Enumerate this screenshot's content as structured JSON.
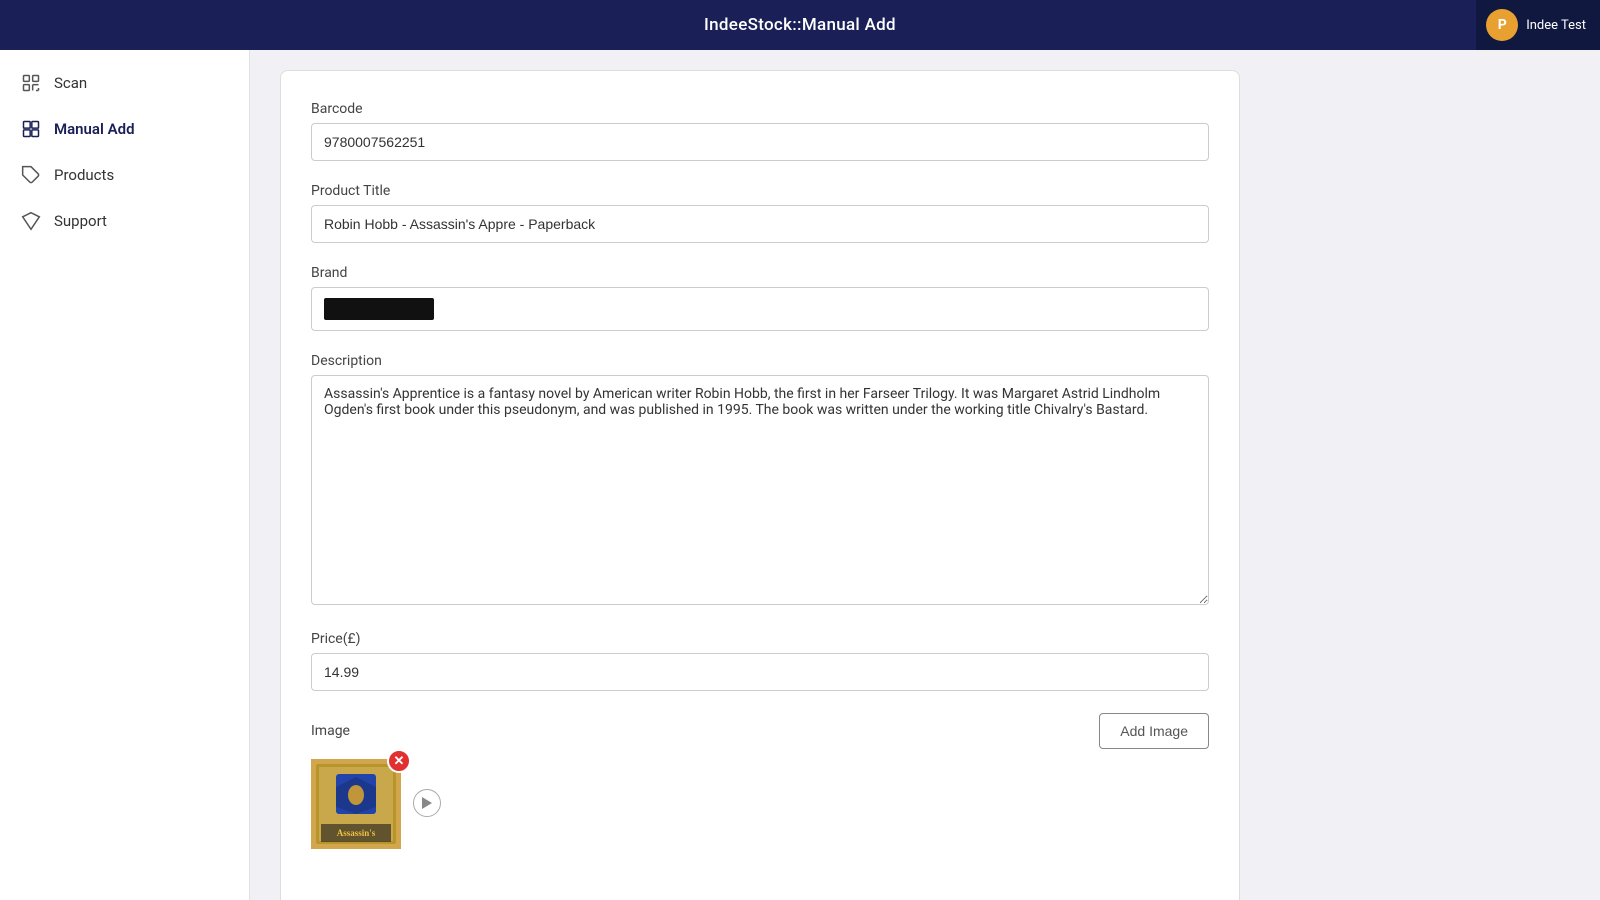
{
  "app": {
    "title": "IndeeStock::Manual Add"
  },
  "user": {
    "initial": "P",
    "name": "Indee Test",
    "avatar_color": "#e8a030"
  },
  "sidebar": {
    "items": [
      {
        "id": "scan",
        "label": "Scan",
        "icon": "scan-icon"
      },
      {
        "id": "manual-add",
        "label": "Manual Add",
        "icon": "grid-icon",
        "active": true
      },
      {
        "id": "products",
        "label": "Products",
        "icon": "tag-icon"
      },
      {
        "id": "support",
        "label": "Support",
        "icon": "diamond-icon"
      }
    ]
  },
  "form": {
    "barcode_label": "Barcode",
    "barcode_value": "9780007562251",
    "product_title_label": "Product Title",
    "product_title_value": "Robin Hobb - Assassin's Appre - Paperback",
    "brand_label": "Brand",
    "brand_value": "",
    "description_label": "Description",
    "description_value": "Assassin's Apprentice is a fantasy novel by American writer Robin Hobb, the first in her Farseer Trilogy. It was Margaret Astrid Lindholm Ogden's first book under this pseudonym, and was published in 1995. The book was written under the working title Chivalry's Bastard.",
    "price_label": "Price(£)",
    "price_value": "14.99",
    "image_label": "Image",
    "add_image_btn": "Add Image"
  }
}
